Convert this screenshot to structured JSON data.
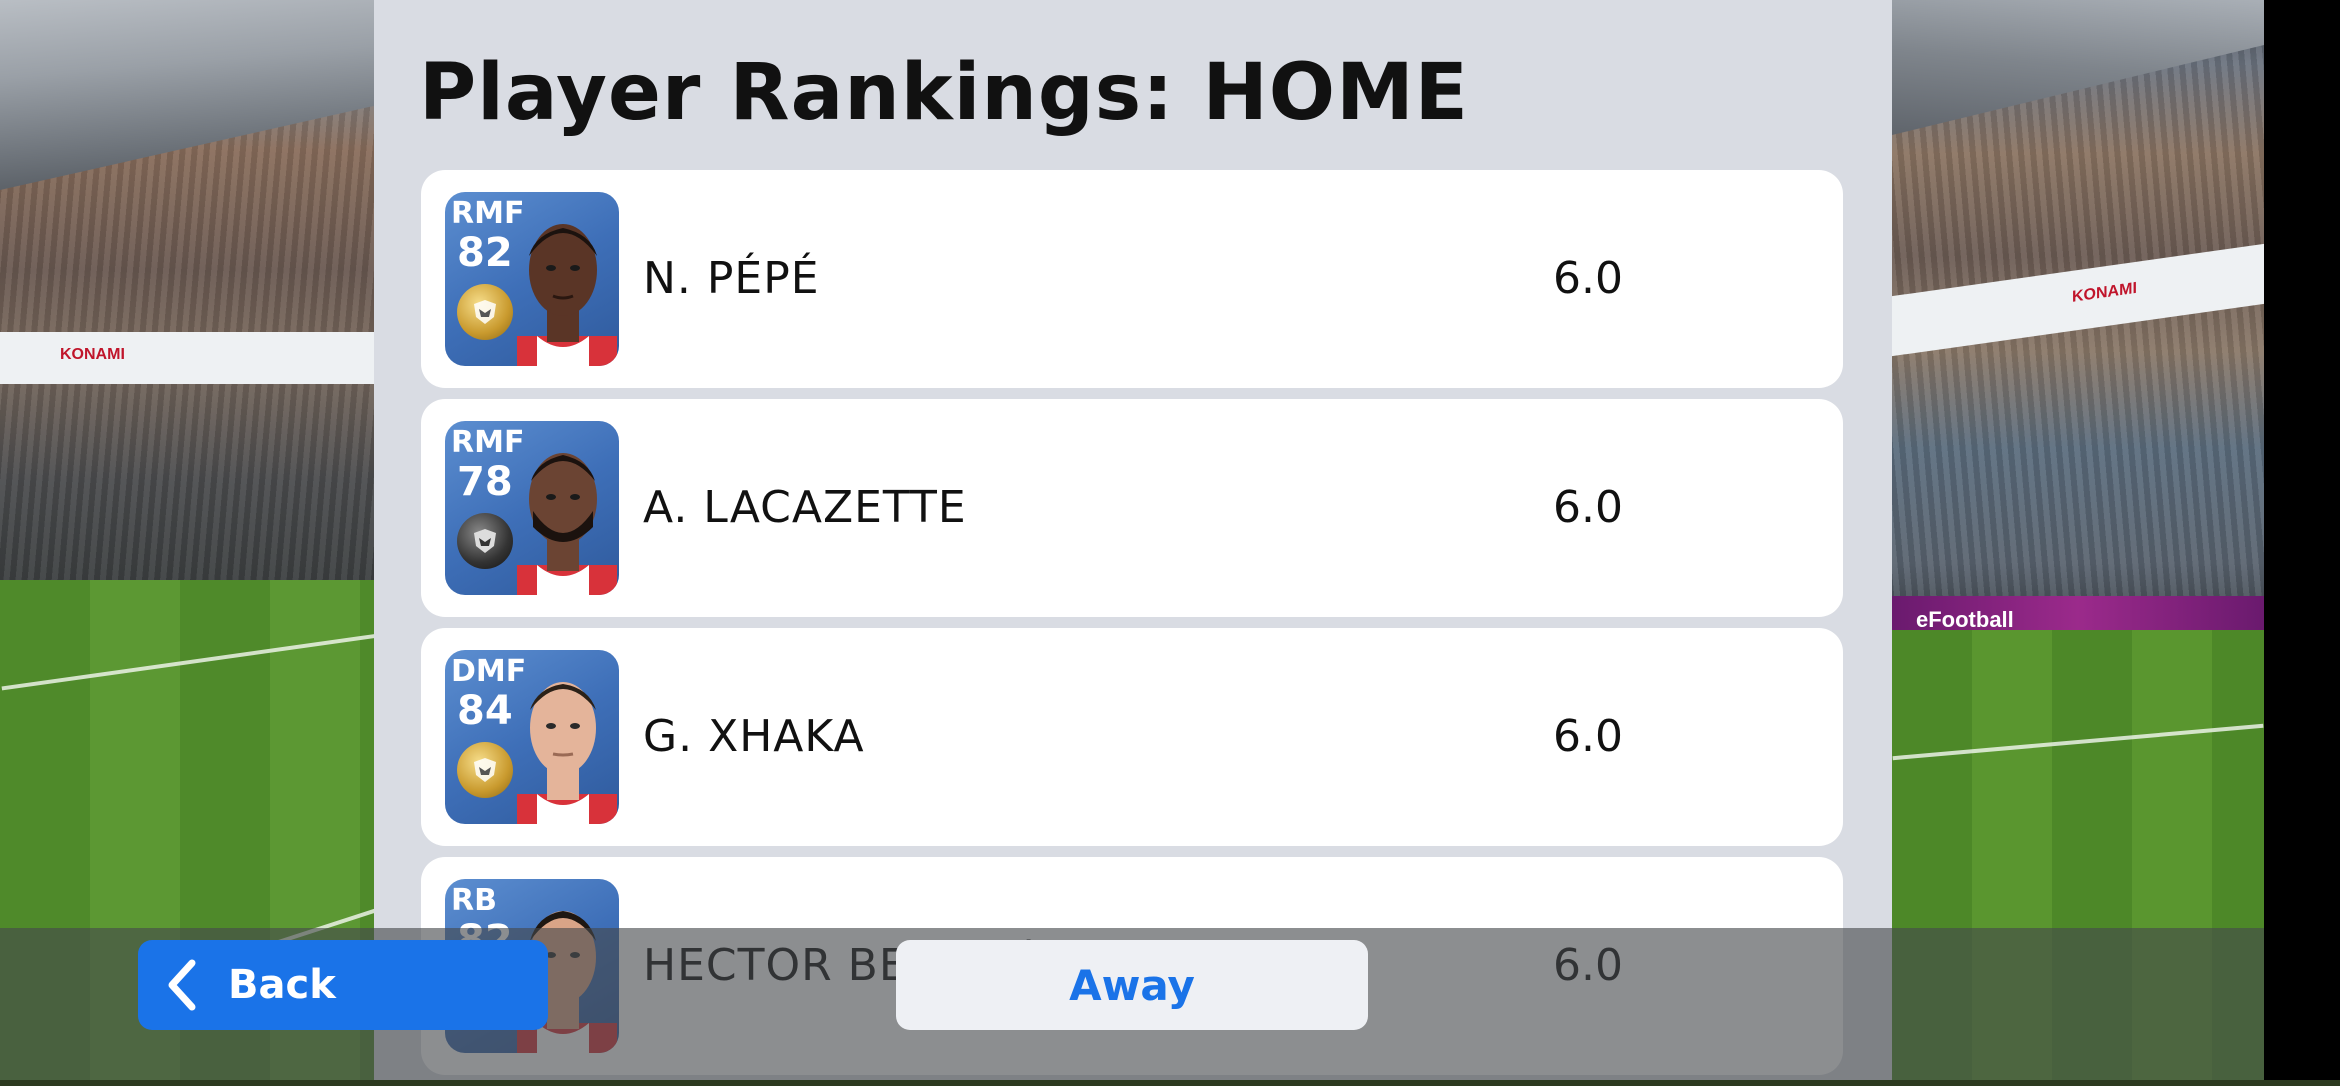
{
  "page": {
    "title": "Player Rankings: HOME"
  },
  "players": [
    {
      "position": "RMF",
      "rating": "82",
      "name": "N. PÉPÉ",
      "score": "6.0",
      "badge": "gold",
      "skin": "#5a3526"
    },
    {
      "position": "RMF",
      "rating": "78",
      "name": "A. LACAZETTE",
      "score": "6.0",
      "badge": "black",
      "skin": "#6b4433"
    },
    {
      "position": "DMF",
      "rating": "84",
      "name": "G. XHAKA",
      "score": "6.0",
      "badge": "gold",
      "skin": "#e4b49a"
    },
    {
      "position": "RB",
      "rating": "82",
      "name": "HECTOR BELLERÍN",
      "score": "6.0",
      "badge": "gold",
      "skin": "#d9a487"
    }
  ],
  "background": {
    "ad_left": "KONAMI",
    "ad_right": "KONAMI",
    "board_right": "eFootball"
  },
  "footer": {
    "back_label": "Back",
    "away_label": "Away"
  },
  "colors": {
    "accent": "#1a73e8",
    "panel": "#d9dce3",
    "card_blue": "#3e6fb8"
  }
}
